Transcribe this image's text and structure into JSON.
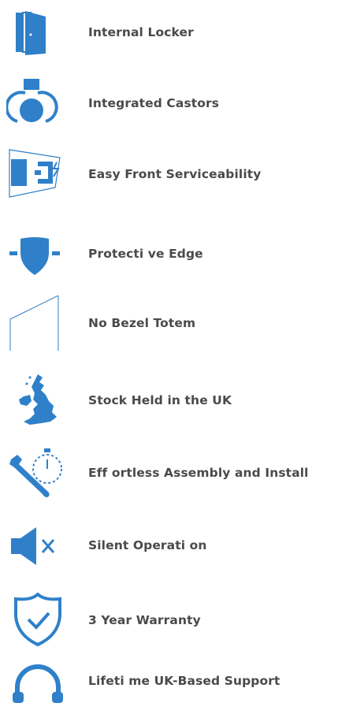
{
  "accent_color": "#2f80c9",
  "features": [
    {
      "icon": "door-icon",
      "label": "Internal Locker"
    },
    {
      "icon": "castor-wheel-icon",
      "label": "Integrated Castors"
    },
    {
      "icon": "front-panel-icon",
      "label": "Easy Front Serviceability"
    },
    {
      "icon": "shield-edge-icon",
      "label": "Protecti ve Edge"
    },
    {
      "icon": "bezel-screen-icon",
      "label": "No Bezel Totem"
    },
    {
      "icon": "uk-map-icon",
      "label": "Stock Held in the UK"
    },
    {
      "icon": "wrench-stopwatch-icon",
      "label": "Eff ortless Assembly and Install"
    },
    {
      "icon": "speaker-mute-icon",
      "label": "Silent Operati on"
    },
    {
      "icon": "shield-check-icon",
      "label": "3 Year Warranty"
    },
    {
      "icon": "headset-icon",
      "label": "Lifeti me UK-Based Support"
    }
  ]
}
